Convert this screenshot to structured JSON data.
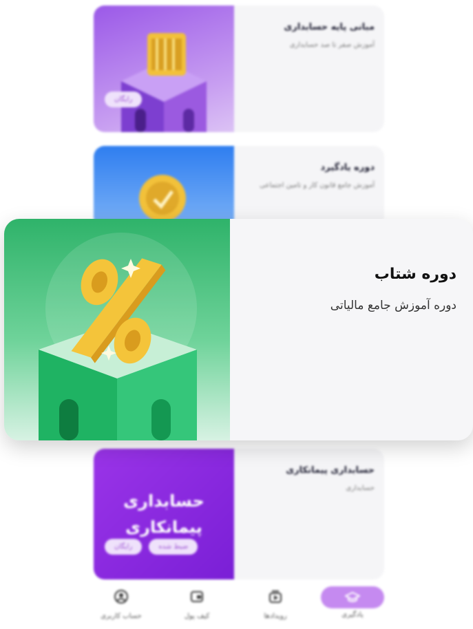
{
  "cards": [
    {
      "title": "مبانی پایه حسابداری",
      "subtitle": "آموزش صفر تا صد حسابداری",
      "tags": [
        "رایگان"
      ]
    },
    {
      "title": "دوره یادگیرد",
      "subtitle": "آموزش جامع قانون کار و تامین اجتماعی",
      "tags": []
    },
    {
      "title": "دوره شتاب",
      "subtitle": "دوره آموزش جامع مالیاتی",
      "tags": []
    },
    {
      "title": "حسابداری پیمانکاری",
      "subtitle": "حسابداری",
      "tags": [
        "ضبط شده",
        "رایگان"
      ],
      "thumb_text_1": "حسابداری",
      "thumb_text_2": "پیمانکاری"
    }
  ],
  "nav": [
    {
      "label": "حساب کاربری",
      "icon": "user-circle-icon"
    },
    {
      "label": "کیف پول",
      "icon": "wallet-icon"
    },
    {
      "label": "رویدادها",
      "icon": "video-icon"
    },
    {
      "label": "یادگیری",
      "icon": "graduation-cap-icon",
      "active": true
    }
  ],
  "colors": {
    "accent": "#c58af0",
    "tag_bg": "#efe2fb",
    "tag_text": "#9a4fd1"
  }
}
